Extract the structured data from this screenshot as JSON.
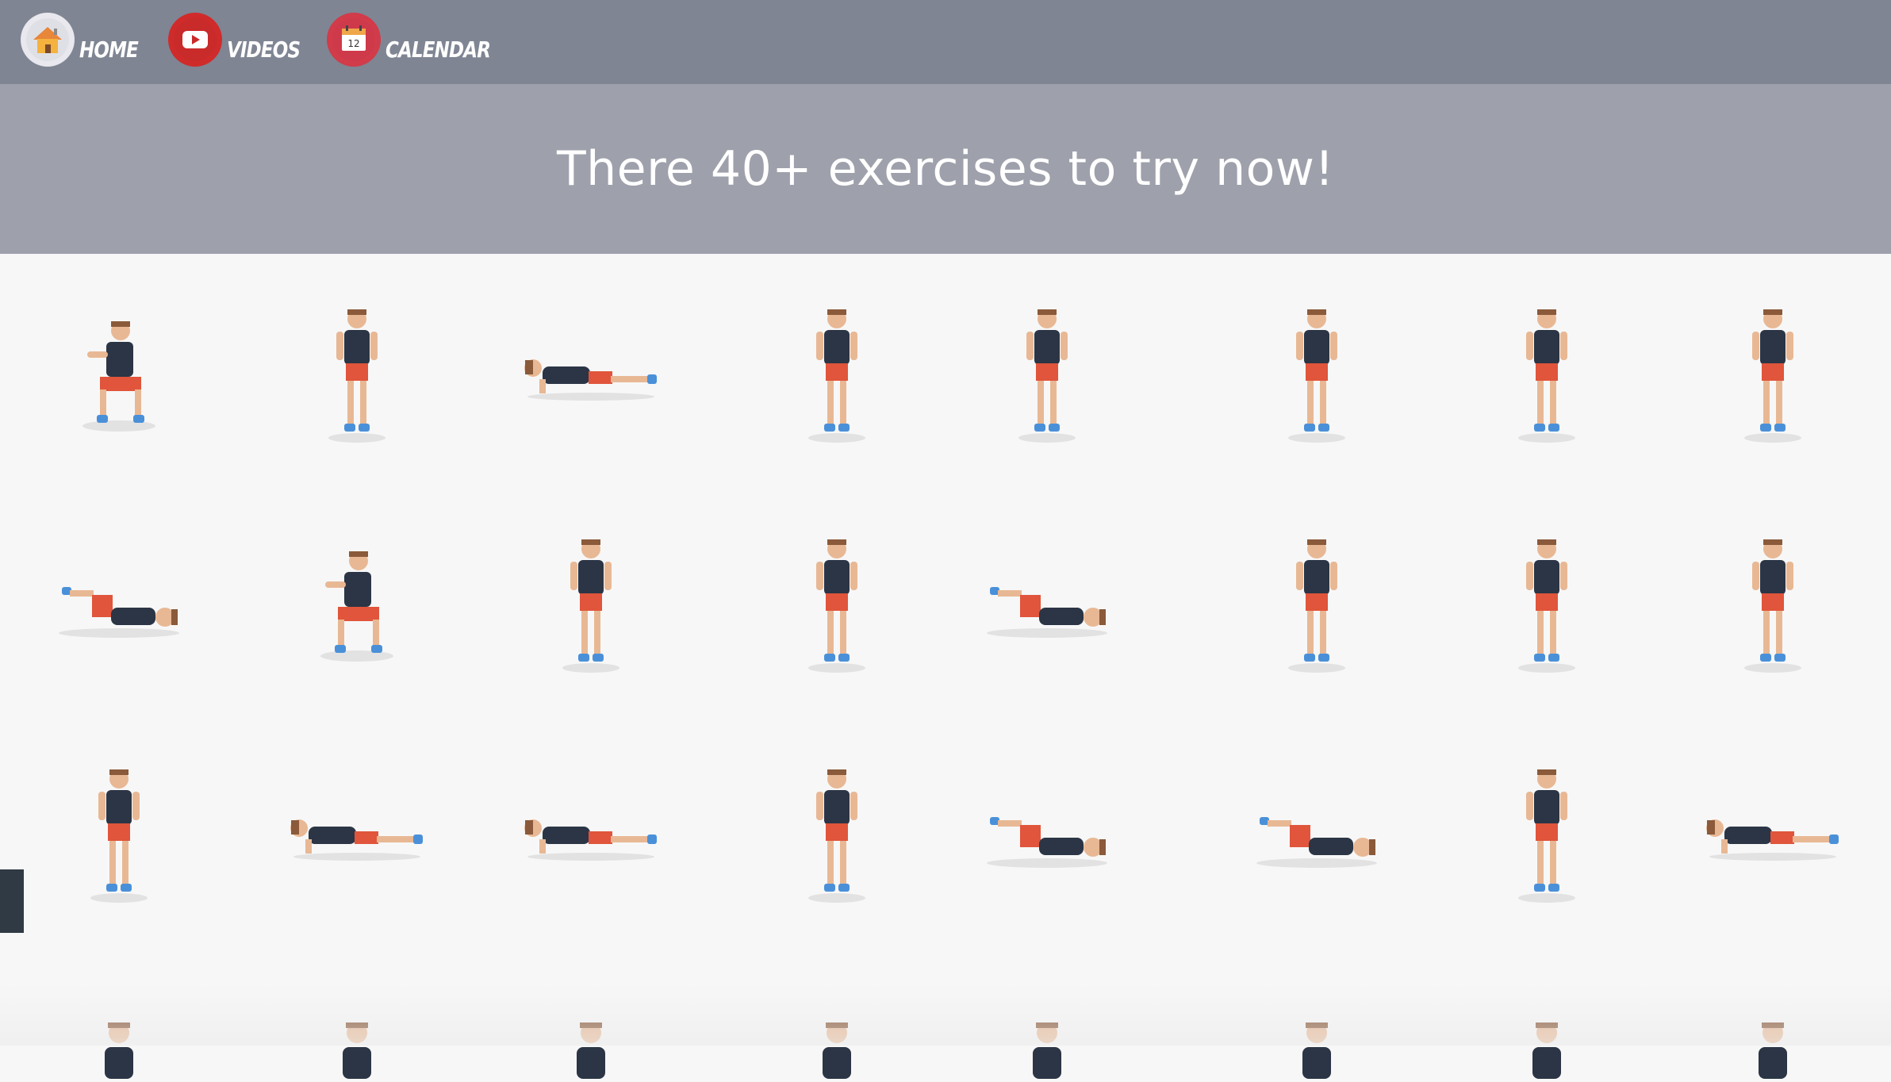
{
  "nav": {
    "items": [
      {
        "label": "HOME",
        "icon": "home-icon"
      },
      {
        "label": "VIDEOS",
        "icon": "play-icon"
      },
      {
        "label": "CALENDAR",
        "icon": "calendar-icon",
        "day": "12"
      }
    ]
  },
  "hero": {
    "title": "There 40+ exercises to try now!"
  },
  "colors": {
    "nav_bg": "#7f8593",
    "hero_bg": "#9ea1ab",
    "page_bg": "#f7f7f7",
    "shirt": "#2b3545",
    "shorts": "#e0553b",
    "skin": "#e8b894",
    "shoe": "#4a90d9"
  }
}
